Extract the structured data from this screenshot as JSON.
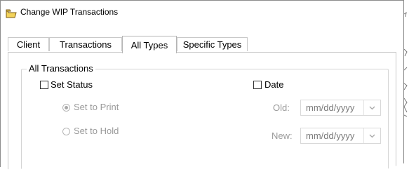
{
  "window": {
    "title": "Change WIP Transactions"
  },
  "tabs": [
    {
      "label": "Client"
    },
    {
      "label": "Transactions"
    },
    {
      "label": "All Types"
    },
    {
      "label": "Specific Types"
    }
  ],
  "group": {
    "label": "All Transactions"
  },
  "set_status": {
    "label": "Set Status",
    "options": [
      {
        "label": "Set to Print"
      },
      {
        "label": "Set to Hold"
      }
    ]
  },
  "date": {
    "label": "Date",
    "old_label": "Old:",
    "new_label": "New:",
    "placeholder": "mm/dd/yyyy"
  },
  "colors": {
    "icon_fill": "#f3d35a",
    "icon_stroke": "#7a5a12",
    "disabled_text": "#9a9a9a",
    "border": "#c9c9c9"
  },
  "icons": [
    "folder-icon",
    "chevron-down-icon"
  ]
}
